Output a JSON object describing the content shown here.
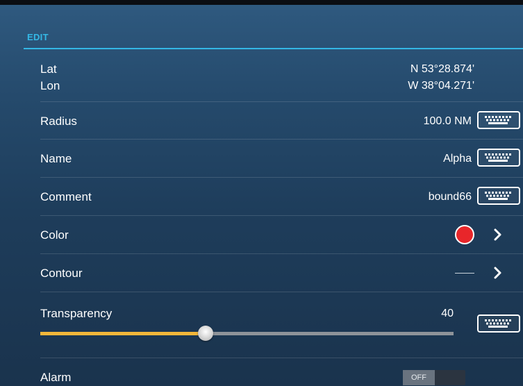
{
  "section": {
    "title": "EDIT"
  },
  "position": {
    "lat_label": "Lat",
    "lat_value": "N 53°28.874'",
    "lon_label": "Lon",
    "lon_value": "W 38°04.271'"
  },
  "radius": {
    "label": "Radius",
    "value": "100.0 NM",
    "keyboard_icon": "keyboard-icon"
  },
  "name": {
    "label": "Name",
    "value": "Alpha",
    "keyboard_icon": "keyboard-icon"
  },
  "comment": {
    "label": "Comment",
    "value": "bound66",
    "keyboard_icon": "keyboard-icon"
  },
  "color": {
    "label": "Color",
    "swatch": "#e8262a",
    "chevron_icon": "chevron-right-icon"
  },
  "contour": {
    "label": "Contour",
    "chevron_icon": "chevron-right-icon"
  },
  "transparency": {
    "label": "Transparency",
    "value": "40",
    "level_percent": 40,
    "fill_color": "#f2b63a",
    "keyboard_icon": "keyboard-icon"
  },
  "alarm": {
    "label": "Alarm",
    "toggle_state": "OFF"
  },
  "colors": {
    "accent": "#34b8e6",
    "background": "#254a6c"
  }
}
